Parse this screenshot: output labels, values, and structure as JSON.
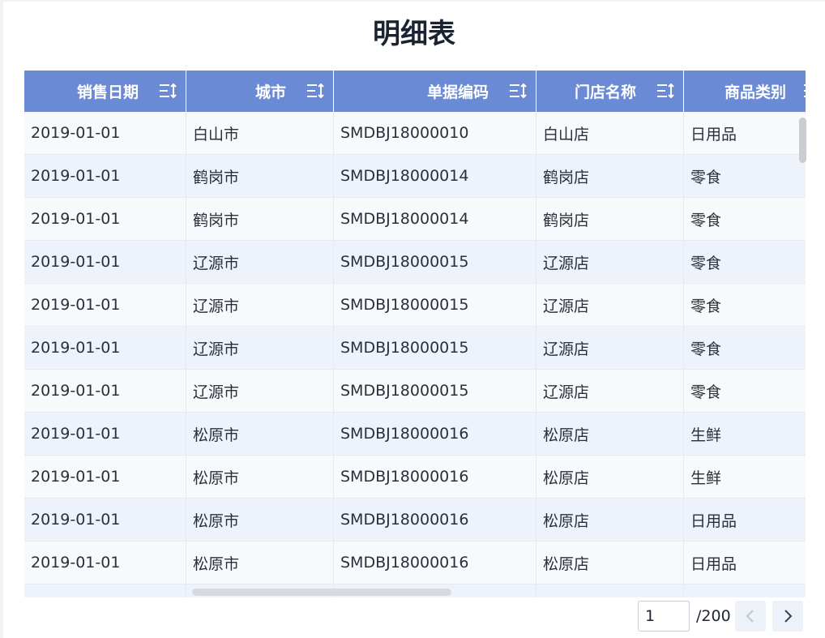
{
  "title": "明细表",
  "columns": [
    {
      "label": "销售日期"
    },
    {
      "label": "城市"
    },
    {
      "label": "单据编码"
    },
    {
      "label": "门店名称"
    },
    {
      "label": "商品类别"
    }
  ],
  "rows": [
    [
      "2019-01-01",
      "白山市",
      "SMDBJ18000010",
      "白山店",
      "日用品"
    ],
    [
      "2019-01-01",
      "鹤岗市",
      "SMDBJ18000014",
      "鹤岗店",
      "零食"
    ],
    [
      "2019-01-01",
      "鹤岗市",
      "SMDBJ18000014",
      "鹤岗店",
      "零食"
    ],
    [
      "2019-01-01",
      "辽源市",
      "SMDBJ18000015",
      "辽源店",
      "零食"
    ],
    [
      "2019-01-01",
      "辽源市",
      "SMDBJ18000015",
      "辽源店",
      "零食"
    ],
    [
      "2019-01-01",
      "辽源市",
      "SMDBJ18000015",
      "辽源店",
      "零食"
    ],
    [
      "2019-01-01",
      "辽源市",
      "SMDBJ18000015",
      "辽源店",
      "零食"
    ],
    [
      "2019-01-01",
      "松原市",
      "SMDBJ18000016",
      "松原店",
      "生鲜"
    ],
    [
      "2019-01-01",
      "松原市",
      "SMDBJ18000016",
      "松原店",
      "生鲜"
    ],
    [
      "2019-01-01",
      "松原市",
      "SMDBJ18000016",
      "松原店",
      "日用品"
    ],
    [
      "2019-01-01",
      "松原市",
      "SMDBJ18000016",
      "松原店",
      "日用品"
    ],
    [
      "",
      "",
      "",
      "",
      ""
    ]
  ],
  "pagination": {
    "current_page": "1",
    "total_label": "/200"
  },
  "colors": {
    "header_bg": "#6b8ad6",
    "row_odd": "#f7f9fd",
    "row_even": "#eef2fa"
  },
  "icons": {
    "sort": "sort-icon",
    "prev": "chevron-left-icon",
    "next": "chevron-right-icon"
  }
}
